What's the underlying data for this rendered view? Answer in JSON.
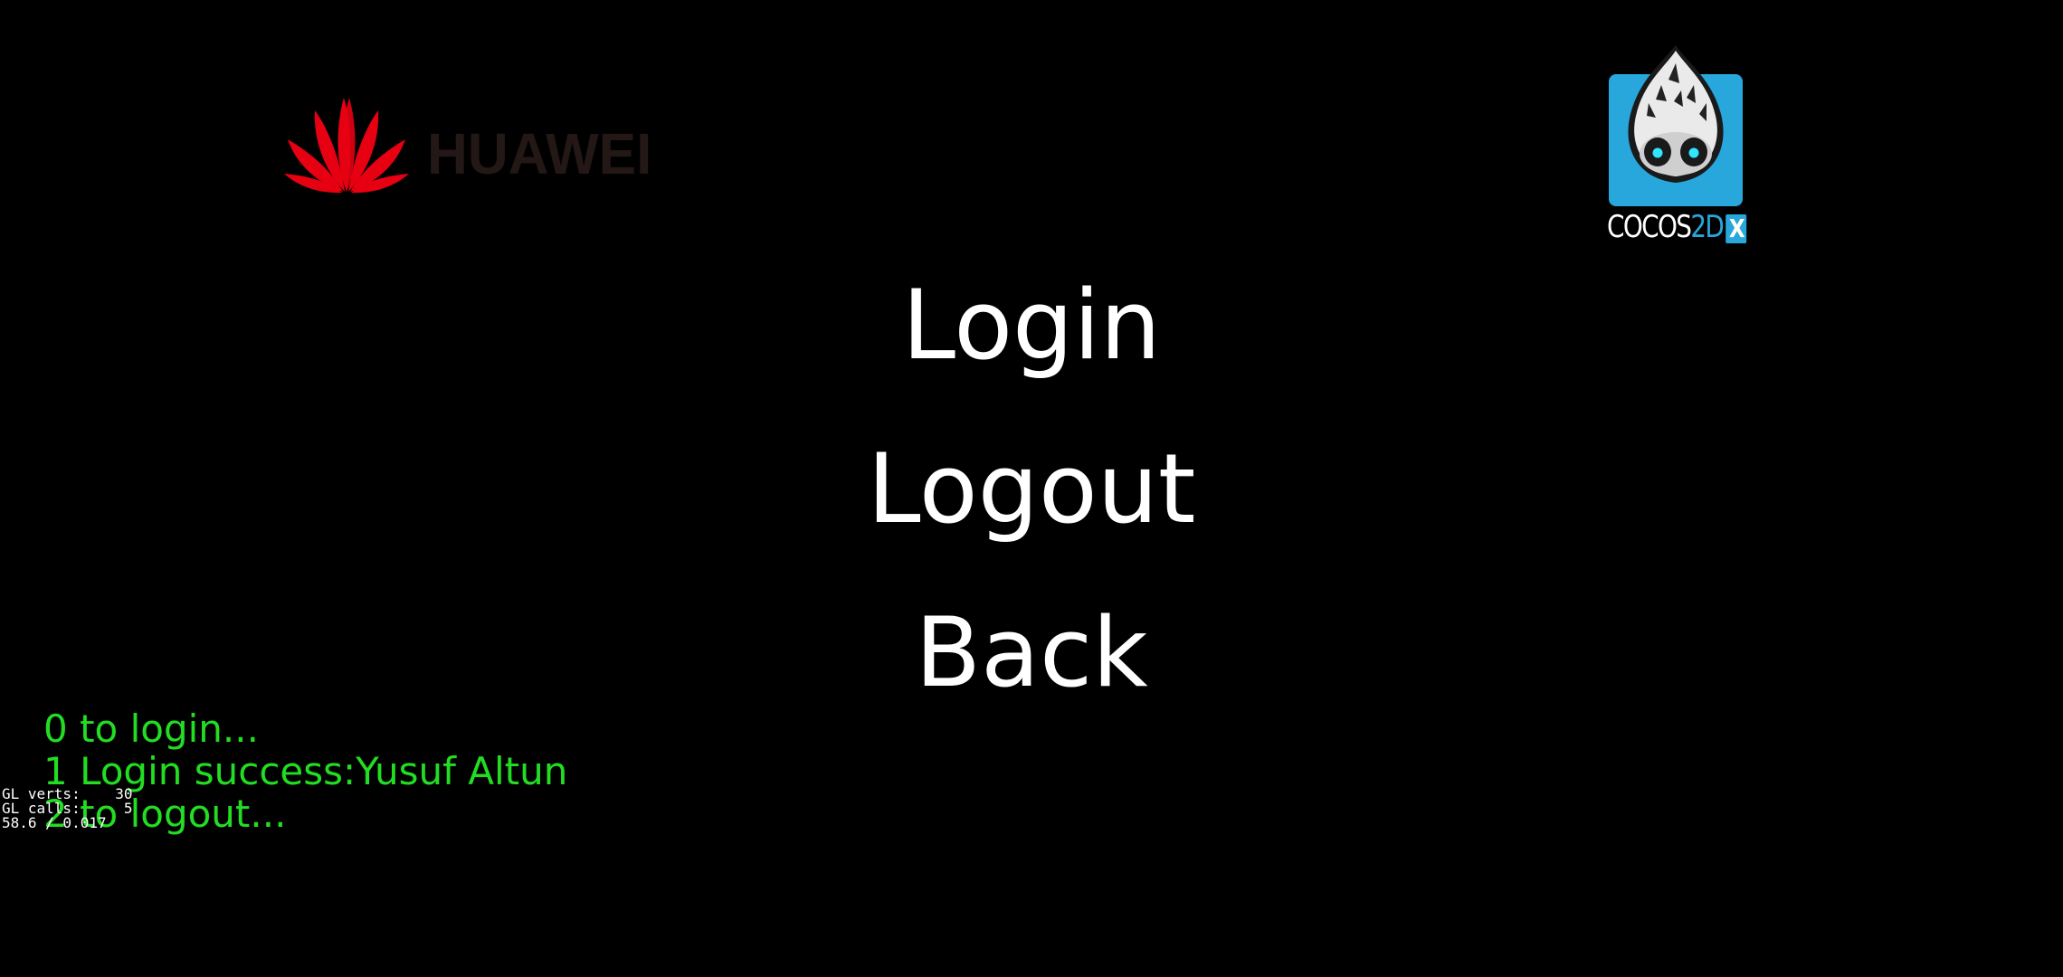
{
  "logos": {
    "huawei": {
      "wordmark": "HUAWEI",
      "icon": "huawei-petal-logo",
      "color": "#e60012"
    },
    "cocos": {
      "wordmark_cocos": "COCOS",
      "wordmark_2d": "2D",
      "wordmark_x": "X",
      "icon": "cocos2dx-mascot-logo",
      "color": "#27a7db"
    }
  },
  "menu": {
    "login_label": "Login",
    "logout_label": "Logout",
    "back_label": "Back"
  },
  "log": {
    "lines": [
      "0 to login...",
      "1 Login success:Yusuf Altun",
      "2 to logout..."
    ],
    "color": "#22dd22"
  },
  "stats": {
    "lines": [
      "GL verts:    30",
      "GL calls:     5",
      "58.6 / 0.017"
    ]
  }
}
